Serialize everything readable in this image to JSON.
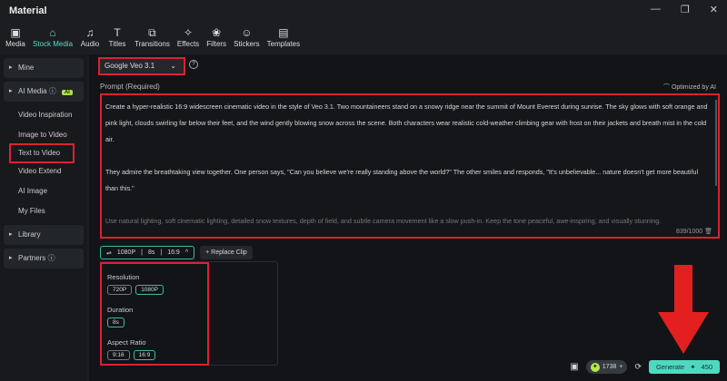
{
  "window": {
    "title": "Material",
    "controls": [
      "—",
      "❐",
      "✕"
    ]
  },
  "tabs": [
    {
      "label": "Media",
      "icon": "▣"
    },
    {
      "label": "Stock Media",
      "icon": "⌂",
      "active": true
    },
    {
      "label": "Audio",
      "icon": "♫"
    },
    {
      "label": "Titles",
      "icon": "T"
    },
    {
      "label": "Transitions",
      "icon": "⧉"
    },
    {
      "label": "Effects",
      "icon": "✧"
    },
    {
      "label": "Filters",
      "icon": "❀"
    },
    {
      "label": "Stickers",
      "icon": "☺"
    },
    {
      "label": "Templates",
      "icon": "▤"
    }
  ],
  "sidebar": {
    "mine": "Mine",
    "ai_media": "AI Media",
    "ai_badge": "AI",
    "items": [
      "Video Inspiration",
      "Image to Video",
      "Text to Video",
      "Video Extend",
      "AI Image",
      "My Files"
    ],
    "library": "Library",
    "partners": "Partners"
  },
  "model": {
    "value": "Google Veo 3.1"
  },
  "prompt": {
    "label": "Prompt (Required)",
    "optimized": "Optimized by AI",
    "paragraphs": [
      "Create a hyper-realistic 16:9 widescreen cinematic video in the style of Veo 3.1. Two mountaineers stand on a snowy ridge near the summit of Mount Everest during sunrise. The sky glows with soft orange and pink light, clouds swirling far below their feet, and the wind gently blowing snow across the scene. Both characters wear realistic cold-weather climbing gear with frost on their jackets and breath mist in the cold air.",
      "They admire the breathtaking view together. One person says, \"Can you believe we're really standing above the world?\" The other smiles and responds, \"It's unbelievable... nature doesn't get more beautiful than this.\"",
      "Use natural lighting, soft cinematic lighting, detailed snow textures, depth of field, and subtle camera movement like a slow push-in. Keep the tone peaceful, awe-inspiring, and visually stunning."
    ],
    "count": "839/1000"
  },
  "chips": {
    "resolution": "1080P",
    "duration": "8s",
    "ratio": "16:9",
    "replace": "+ Replace Clip"
  },
  "settings": {
    "resolution_label": "Resolution",
    "resolutions": [
      "720P",
      "1080P"
    ],
    "duration_label": "Duration",
    "durations": [
      "8s"
    ],
    "ratio_label": "Aspect Ratio",
    "ratios": [
      "9:16",
      "16:9"
    ]
  },
  "footer": {
    "credits": "1738",
    "generate": "Generate",
    "cost": "450"
  },
  "colors": {
    "accent": "#4fd8c0",
    "highlight": "#d9232e"
  }
}
